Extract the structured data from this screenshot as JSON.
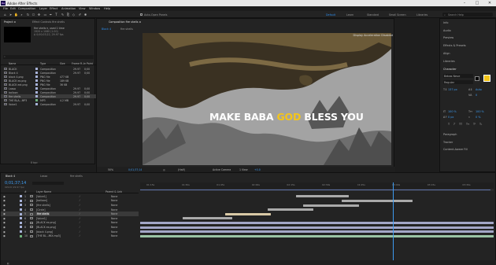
{
  "app": {
    "title": "Adobe After Effects",
    "logo_text": "Ae",
    "window_controls": [
      "–",
      "□",
      "✕"
    ]
  },
  "menu": [
    "File",
    "Edit",
    "Composition",
    "Layer",
    "Effect",
    "Animation",
    "View",
    "Window",
    "Help"
  ],
  "toolbar": {
    "auto_open_panels": "Auto-Open Panels",
    "workspaces": [
      {
        "label": "Default",
        "active": true
      },
      {
        "label": "Learn",
        "active": false
      },
      {
        "label": "Standard",
        "active": false
      },
      {
        "label": "Small Screen",
        "active": false
      },
      {
        "label": "Libraries",
        "active": false
      }
    ],
    "search_placeholder": "Search Help"
  },
  "project_panel": {
    "tabs": [
      "Project ≡",
      "Effect Controls fire shells"
    ],
    "preview_name": "fire shells ▾, used 1 time",
    "preview_size": "1920 x 1080 (1.00)",
    "preview_duration": "Δ 0;00;03;22, 29.97 fps",
    "search_placeholder": "⌕",
    "columns": {
      "name": "Name",
      "type": "Type",
      "size": "Size",
      "fps": "Frame R...",
      "inpoint": "In Point"
    },
    "items": [
      {
        "name": "BLACK",
        "type": "Composition",
        "size": "",
        "fps": "29.97",
        "in": "0;00",
        "color": "#a7b2d8"
      },
      {
        "name": "Black 4",
        "type": "Composition",
        "size": "",
        "fps": "29.97",
        "in": "0;00",
        "color": "#a7b2d8"
      },
      {
        "name": "black 4.png",
        "type": "PNG file",
        "size": "477 KB",
        "fps": "",
        "in": "",
        "color": "#a7b2d8"
      },
      {
        "name": "BLACK ex.png",
        "type": "PNG file",
        "size": "189 KB",
        "fps": "",
        "in": "",
        "color": "#a7b2d8"
      },
      {
        "name": "BLACK ext.png",
        "type": "PNG file",
        "size": "36 KB",
        "fps": "",
        "in": "",
        "color": "#a7b2d8"
      },
      {
        "name": "Lasso",
        "type": "Composition",
        "size": "",
        "fps": "29.97",
        "in": "0;00",
        "color": "#a7b2d8"
      },
      {
        "name": "balloon",
        "type": "Composition",
        "size": "",
        "fps": "29.97",
        "in": "0;00",
        "color": "#a7b2d8"
      },
      {
        "name": "fire shells",
        "type": "Composition",
        "size": "",
        "fps": "29.97",
        "in": "0;00",
        "color": "#a7b2d8",
        "selected": true
      },
      {
        "name": "THE BLA...MP3",
        "type": "MP3",
        "size": "4.2 MB",
        "fps": "",
        "in": "",
        "color": "#6fb37d"
      },
      {
        "name": "Voice1",
        "type": "Composition",
        "size": "",
        "fps": "29.97",
        "in": "0;00",
        "color": "#a7b2d8"
      }
    ],
    "bpc": "8 bpc"
  },
  "composition_panel": {
    "tab_label": "Composition fire shells ≡",
    "breadcrumbs": [
      "Black 4",
      "fire shells"
    ],
    "gpu_notice": "Display Acceleration Disabled",
    "caption": {
      "before": "MAKE BABA ",
      "highlight": "GOD",
      "after": " BLESS YOU"
    },
    "zoom": "50%",
    "timecode": "0;01;37;14",
    "resolution": "(Half)",
    "camera": "Active Camera",
    "views": "1 View",
    "offset": "+0.0"
  },
  "right_panel": {
    "items": [
      "Info",
      "Audio",
      "Preview",
      "Effects & Presets",
      "Align",
      "Libraries"
    ],
    "character": {
      "title": "Character",
      "font": "Bebas Neue",
      "style": "Regular",
      "size": "137 px",
      "leading": "Auto",
      "tracking": "0",
      "scale_v": "100 %",
      "scale_h": "100 %",
      "baseline": "0 px",
      "tsume": "0 %",
      "fill_color": "#f5c518",
      "style_buttons": [
        "T",
        "T",
        "TT",
        "Tт",
        "T¹",
        "T₁"
      ]
    },
    "bottom_items": [
      "Paragraph",
      "Tracker",
      "Content-Aware Fill"
    ]
  },
  "timeline": {
    "tabs": [
      {
        "label": "Black 4",
        "active": true
      },
      {
        "label": "Lasso",
        "active": false
      },
      {
        "label": "fire shells",
        "active": false
      }
    ],
    "timecode": "0;01;37;14",
    "timecode_sub": "02919 (29.97 fps)",
    "columns": {
      "num": "#",
      "name": "Layer Name",
      "parent": "Parent & Link"
    },
    "ruler": [
      "01:15s",
      "01:30s",
      "01:45s",
      "02:00s",
      "02:15s",
      "02:30s",
      "02:45s",
      "03:00s",
      "03:15s",
      "03:30s"
    ],
    "playhead_fraction": 0.715,
    "work_area_end_fraction": 0.99,
    "layers": [
      {
        "num": "1",
        "name": "[Voice1]",
        "parent": "None",
        "color": "#a7b2d8",
        "bar_start": 0.44,
        "bar_end": 0.59,
        "bar_color": "#aaaaaa"
      },
      {
        "num": "2",
        "name": "[balloon]",
        "parent": "None",
        "color": "#a7b2d8",
        "bar_start": 0.57,
        "bar_end": 0.77,
        "bar_color": "#aaaaaa"
      },
      {
        "num": "3",
        "name": "[fire shells]",
        "parent": "None",
        "color": "#a7b2d8",
        "bar_start": 0.46,
        "bar_end": 0.62,
        "bar_color": "#aaaaaa"
      },
      {
        "num": "4",
        "name": "[Circle]",
        "parent": "None",
        "color": "#a7b2d8",
        "bar_start": 0.36,
        "bar_end": 0.49,
        "bar_color": "#aaaaaa"
      },
      {
        "num": "5",
        "name": "fire shells",
        "parent": "None",
        "color": "#a7b2d8",
        "bar_start": 0.24,
        "bar_end": 0.37,
        "bar_color": "#d9c9a6",
        "selected": true
      },
      {
        "num": "6",
        "name": "[Voice1]",
        "parent": "None",
        "color": "#a7b2d8",
        "bar_start": 0.12,
        "bar_end": 0.26,
        "bar_color": "#aaaaaa"
      },
      {
        "num": "7",
        "name": "[BLACK ex.png]",
        "parent": "None",
        "color": "#a7b2d8",
        "bar_start": 0.0,
        "bar_end": 1.0,
        "bar_color": "#a3a6c6"
      },
      {
        "num": "8",
        "name": "[BLACK ex.png]",
        "parent": "None",
        "color": "#a7b2d8",
        "bar_start": 0.0,
        "bar_end": 1.0,
        "bar_color": "#a3a6c6"
      },
      {
        "num": "9",
        "name": "[black 4.png]",
        "parent": "None",
        "color": "#a7b2d8",
        "bar_start": 0.0,
        "bar_end": 1.0,
        "bar_color": "#a3a6c6"
      },
      {
        "num": "10",
        "name": "[THE BL...MIX.mp3]",
        "parent": "None",
        "color": "#6fb37d",
        "bar_start": 0.0,
        "bar_end": 1.0,
        "bar_color": "#9bc4a5"
      }
    ]
  }
}
